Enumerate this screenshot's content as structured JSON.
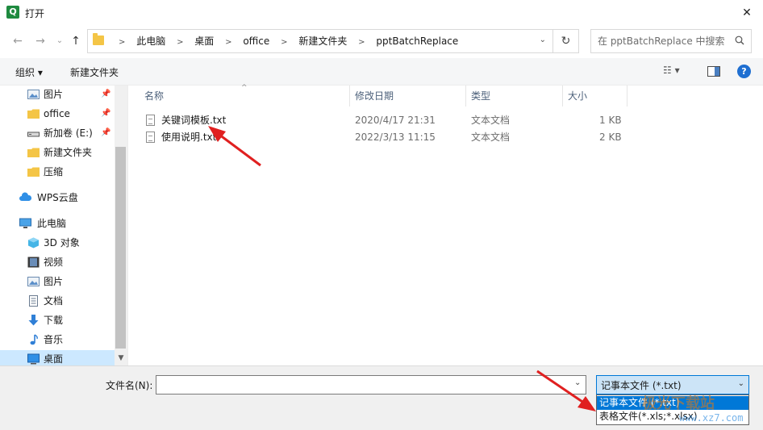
{
  "window": {
    "title": "打开",
    "app_icon_letter": "Q"
  },
  "nav": {
    "breadcrumbs": [
      "此电脑",
      "桌面",
      "office",
      "新建文件夹",
      "pptBatchReplace"
    ],
    "search_placeholder": "在 pptBatchReplace 中搜索"
  },
  "toolbar": {
    "organize": "组织 ▾",
    "new_folder": "新建文件夹",
    "view": "☷ ▾"
  },
  "sidebar": {
    "items": [
      {
        "label": "图片",
        "icon": "pictures-icon",
        "pinned": true
      },
      {
        "label": "office",
        "icon": "folder-icon",
        "pinned": true
      },
      {
        "label": "新加卷 (E:)",
        "icon": "drive-icon",
        "pinned": true
      },
      {
        "label": "新建文件夹",
        "icon": "folder-icon"
      },
      {
        "label": "压缩",
        "icon": "folder-icon"
      },
      {
        "label": "WPS云盘",
        "icon": "cloud-icon"
      },
      {
        "label": "此电脑",
        "icon": "computer-icon"
      },
      {
        "label": "3D 对象",
        "icon": "cube-icon"
      },
      {
        "label": "视频",
        "icon": "video-icon"
      },
      {
        "label": "图片",
        "icon": "pictures-icon"
      },
      {
        "label": "文档",
        "icon": "document-icon"
      },
      {
        "label": "下载",
        "icon": "download-icon"
      },
      {
        "label": "音乐",
        "icon": "music-icon"
      },
      {
        "label": "桌面",
        "icon": "desktop-icon",
        "selected": true
      }
    ]
  },
  "columns": [
    "名称",
    "修改日期",
    "类型",
    "大小"
  ],
  "files": [
    {
      "name": "关键词模板.txt",
      "modified": "2020/4/17 21:31",
      "type": "文本文档",
      "size": "1 KB"
    },
    {
      "name": "使用说明.txt",
      "modified": "2022/3/13 11:15",
      "type": "文本文档",
      "size": "2 KB"
    }
  ],
  "bottom": {
    "filename_label": "文件名(N):",
    "filename_value": "",
    "filetype_selected": "记事本文件 (*.txt)",
    "filetype_options": [
      "记事本文件 (*.txt)",
      "表格文件(*.xls;*.xlsx)"
    ]
  },
  "watermark": {
    "text": "极光下载站",
    "url": "www.xz7.com"
  },
  "colors": {
    "accent": "#0078d7",
    "selection": "#cce8ff",
    "annotation_arrow": "#e02020"
  }
}
